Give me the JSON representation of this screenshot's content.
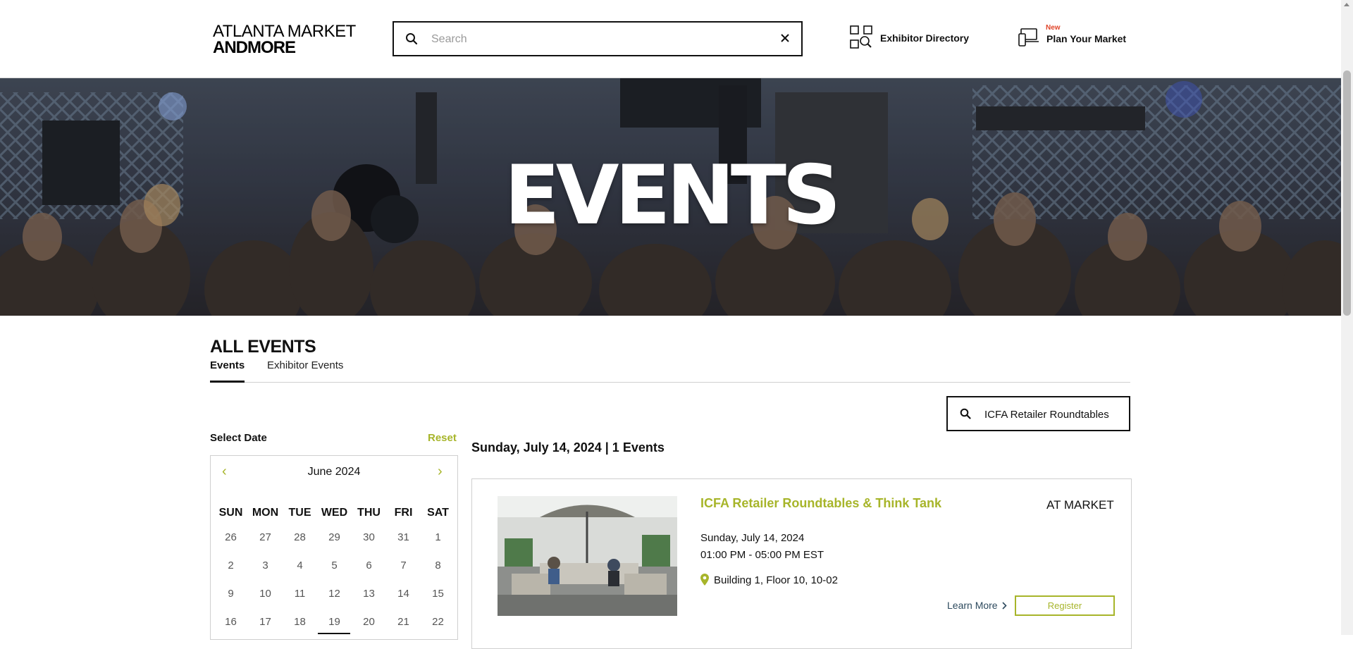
{
  "header": {
    "logo_line1": "ATLANTA MARKET",
    "logo_line2": "ANDMORE",
    "search_placeholder": "Search",
    "exhibitor_directory_label": "Exhibitor Directory",
    "plan_badge": "New",
    "plan_label": "Plan Your Market"
  },
  "hero": {
    "title": "EVENTS"
  },
  "main": {
    "section_title": "ALL EVENTS",
    "tabs": [
      {
        "label": "Events",
        "active": true
      },
      {
        "label": "Exhibitor Events",
        "active": false
      }
    ],
    "event_search_value": "ICFA Retailer Roundtables",
    "select_date_label": "Select Date",
    "reset_label": "Reset"
  },
  "calendar": {
    "prev": "‹",
    "next": "›",
    "month": "June 2024",
    "weekdays": [
      "SUN",
      "MON",
      "TUE",
      "WED",
      "THU",
      "FRI",
      "SAT"
    ],
    "weeks": [
      [
        "26",
        "27",
        "28",
        "29",
        "30",
        "31",
        "1"
      ],
      [
        "2",
        "3",
        "4",
        "5",
        "6",
        "7",
        "8"
      ],
      [
        "9",
        "10",
        "11",
        "12",
        "13",
        "14",
        "15"
      ],
      [
        "16",
        "17",
        "18",
        "19",
        "20",
        "21",
        "22"
      ]
    ]
  },
  "results": {
    "heading": "Sunday, July 14, 2024 | 1 Events",
    "events": [
      {
        "title": "ICFA Retailer Roundtables & Think Tank",
        "type": "AT MARKET",
        "date": "Sunday, July 14, 2024",
        "time": "01:00 PM - 05:00 PM EST",
        "location": "Building 1, Floor 10, 10-02",
        "learn_more": "Learn More",
        "register": "Register"
      }
    ]
  },
  "colors": {
    "accent": "#a7b52a",
    "new_badge": "#e0452a",
    "text": "#111111"
  }
}
